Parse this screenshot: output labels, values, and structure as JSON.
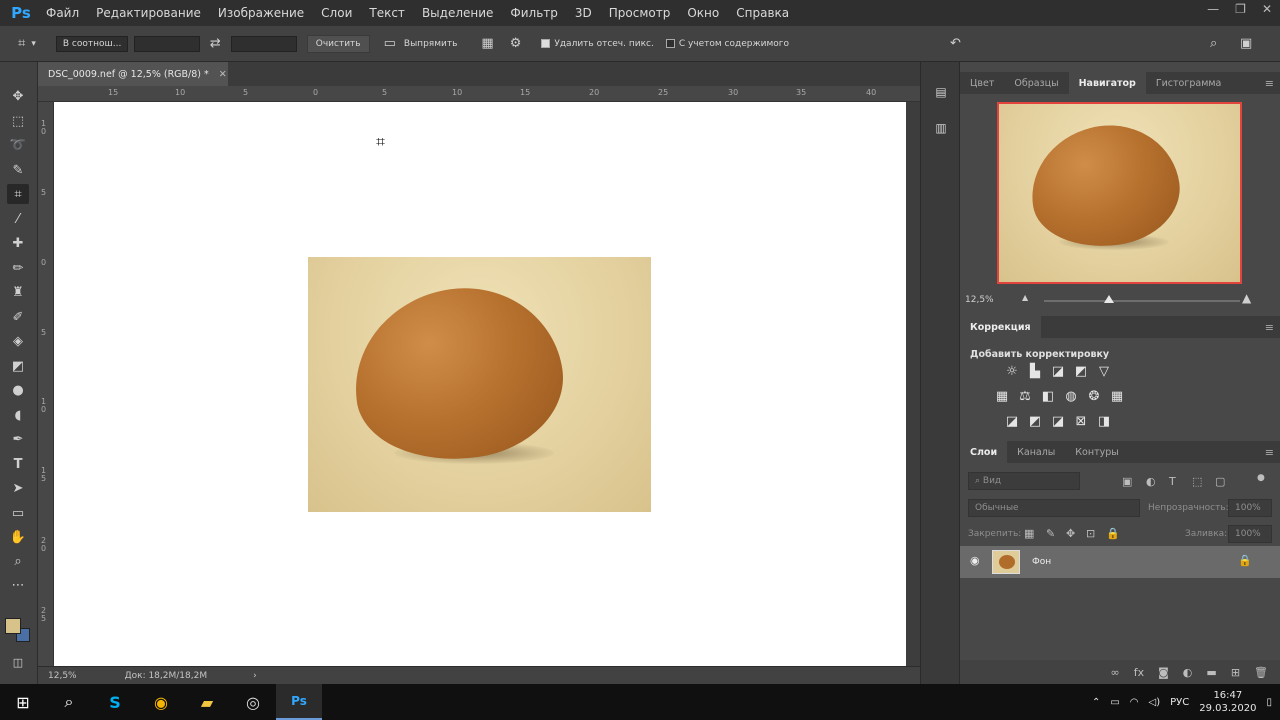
{
  "app": {
    "logo": "Ps",
    "menu": [
      "Файл",
      "Редактирование",
      "Изображение",
      "Слои",
      "Текст",
      "Выделение",
      "Фильтр",
      "3D",
      "Просмотр",
      "Окно",
      "Справка"
    ],
    "window_controls": {
      "minimize": "—",
      "restore": "❐",
      "close": "✕"
    }
  },
  "options_bar": {
    "ratio_select": "В соотнош...",
    "swap_icon": "⇄",
    "clear_button": "Очистить",
    "straighten_label": "Выпрямить",
    "delete_cropped_label": "Удалить отсеч. пикс.",
    "delete_cropped_checked": true,
    "content_aware_label": "С учетом содержимого",
    "content_aware_checked": false
  },
  "document_tab": {
    "title": "DSC_0009.nef @ 12,5% (RGB/8) *",
    "close": "✕"
  },
  "ruler": {
    "top": [
      "15",
      "10",
      "5",
      "0",
      "5",
      "10",
      "15",
      "20",
      "25",
      "30",
      "35",
      "40"
    ],
    "left": [
      "1 0",
      "5",
      "0",
      "5",
      "1 0",
      "1 5",
      "2 0",
      "2 5"
    ]
  },
  "status_bar": {
    "zoom": "12,5%",
    "doc_size": "Док: 18,2M/18,2M",
    "arrow": "›"
  },
  "panels": {
    "top_tabs": [
      "Цвет",
      "Образцы",
      "Навигатор",
      "Гистограмма"
    ],
    "top_active": "Навигатор",
    "navigator_zoom": "12,5%",
    "navigator_slider_fraction": 0.33,
    "correction_tab": "Коррекция",
    "correction_subtitle": "Добавить корректировку",
    "layers_tabs": [
      "Слои",
      "Каналы",
      "Контуры"
    ],
    "layers_active": "Слои",
    "filter_placeholder": "Вид",
    "blend_mode": "Обычные",
    "opacity_label": "Непрозрачность:",
    "opacity_value": "100%",
    "lock_label": "Закрепить:",
    "fill_label": "Заливка:",
    "fill_value": "100%",
    "layer_name": "Фон"
  },
  "taskbar": {
    "language": "РУС",
    "time": "16:47",
    "date": "29.03.2020"
  },
  "colors": {
    "ps_blue": "#31a8ff",
    "navigator_frame": "#e2433d",
    "foreground_swatch": "#d7c28a",
    "background_swatch": "#4a6fa5"
  }
}
